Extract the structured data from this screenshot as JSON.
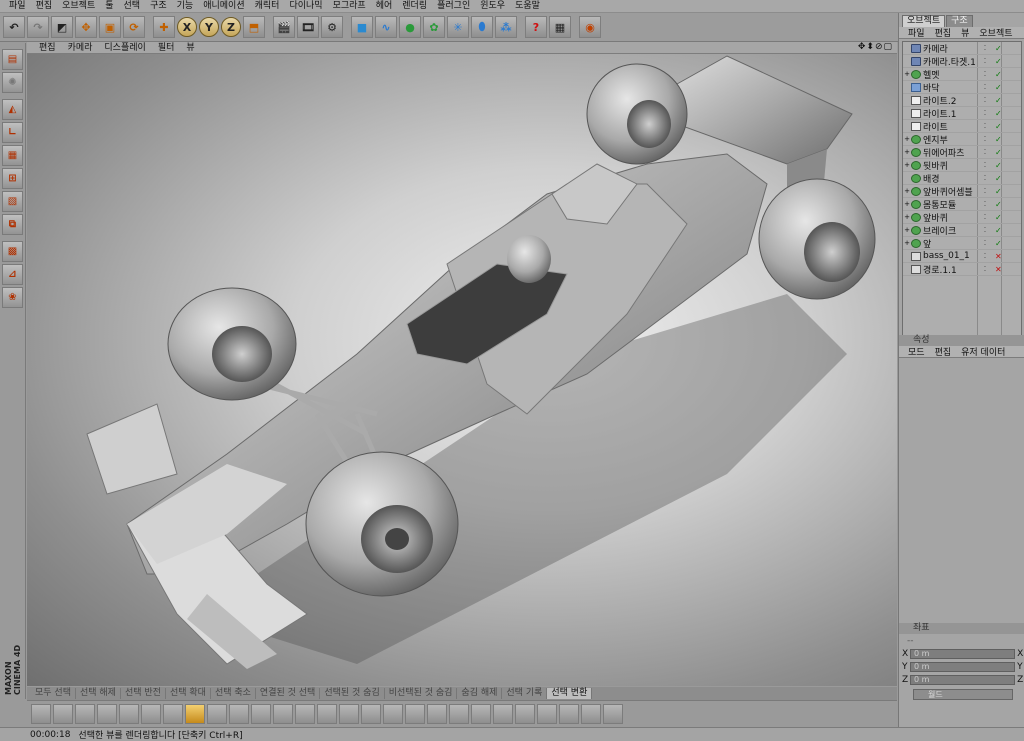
{
  "menubar": [
    "파일",
    "편집",
    "오브젝트",
    "툴",
    "선택",
    "구조",
    "기능",
    "애니메이션",
    "캐릭터",
    "다이나믹",
    "모그라프",
    "헤어",
    "렌더링",
    "플러그인",
    "윈도우",
    "도움말"
  ],
  "toolbar": {
    "axis_x": "X",
    "axis_y": "Y",
    "axis_z": "Z"
  },
  "viewport": {
    "menu": [
      "편집",
      "카메라",
      "디스플레이",
      "필터",
      "뷰"
    ],
    "nav_icons": "✥⬍⊘▢"
  },
  "selection_tabs": [
    "모두 선택",
    "선택 해제",
    "선택 반전",
    "선택 확대",
    "선택 축소",
    "연결된 것 선택",
    "선택된 것 숨김",
    "비선택된 것 숨김",
    "숨김 해제",
    "선택 기록",
    "선택 변환"
  ],
  "status": {
    "time": "00:00:18",
    "message": "선택한 뷰를 렌더링합니다 [단축키 Ctrl+R]"
  },
  "brand": {
    "line1": "MAXON",
    "line2": "CINEMA 4D"
  },
  "right_panel": {
    "tabs": [
      "오브젝트",
      "구조"
    ],
    "menu": [
      "파일",
      "편집",
      "뷰",
      "오브젝트"
    ],
    "objects": [
      {
        "label": "카메라",
        "icon": "camera-icon",
        "expand": ""
      },
      {
        "label": "카메라.타겟.1",
        "icon": "null-icon",
        "expand": ""
      },
      {
        "label": "헬멧",
        "icon": "object-icon",
        "expand": "+"
      },
      {
        "label": "바닥",
        "icon": "floor-icon",
        "expand": ""
      },
      {
        "label": "라이트.2",
        "icon": "light-icon",
        "expand": ""
      },
      {
        "label": "라이트.1",
        "icon": "light-icon",
        "expand": ""
      },
      {
        "label": "라이트",
        "icon": "light-icon",
        "expand": ""
      },
      {
        "label": "엔지부",
        "icon": "object-icon",
        "expand": "+"
      },
      {
        "label": "뒤에어파츠",
        "icon": "object-icon",
        "expand": "+"
      },
      {
        "label": "뒷바퀴",
        "icon": "object-icon",
        "expand": "+"
      },
      {
        "label": "배경",
        "icon": "object-icon",
        "expand": ""
      },
      {
        "label": "앞바퀴어셈블",
        "icon": "object-icon",
        "expand": "+"
      },
      {
        "label": "몸통모듈",
        "icon": "object-icon",
        "expand": "+"
      },
      {
        "label": "앞바퀴",
        "icon": "object-icon",
        "expand": "+"
      },
      {
        "label": "브레이크",
        "icon": "object-icon",
        "expand": "+"
      },
      {
        "label": "앞",
        "icon": "object-icon",
        "expand": "+"
      },
      {
        "label": "bass_01_1",
        "icon": "spline-icon",
        "expand": ""
      },
      {
        "label": "경로.1.1",
        "icon": "spline-icon",
        "expand": ""
      }
    ],
    "attributes": {
      "header": "속성",
      "menu": [
        "모드",
        "편집",
        "유저 데이터"
      ]
    },
    "coordinates": {
      "header": "좌표",
      "sub": "--",
      "x_label": "X",
      "y_label": "Y",
      "z_label": "Z",
      "x_value": "0 m",
      "y_value": "0 m",
      "z_value": "0 m",
      "mode": "월드"
    }
  },
  "colors": {
    "accent": "#e0a020",
    "ok": "#0a7a0a",
    "error": "#c01010"
  }
}
